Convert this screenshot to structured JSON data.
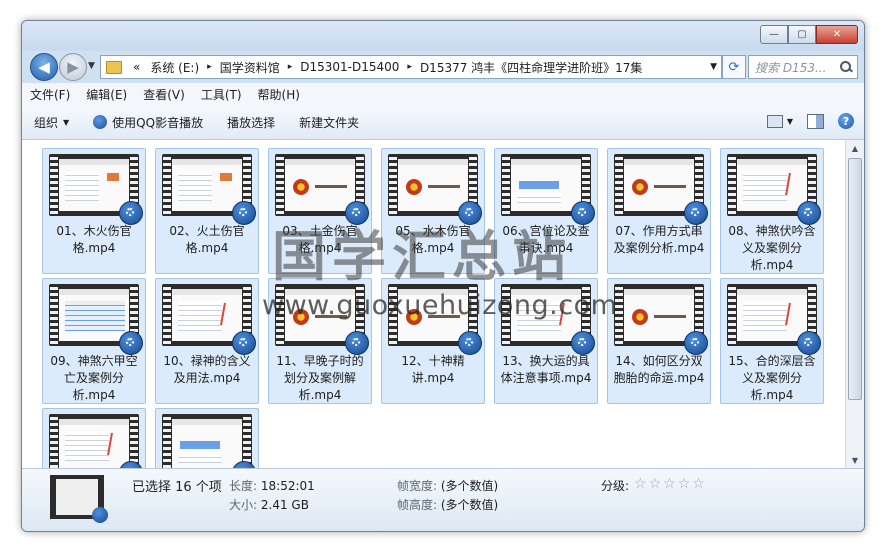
{
  "address": {
    "history_chevron": "«",
    "crumbs": [
      "系统 (E:)",
      "国学资料馆",
      "D15301-D15400",
      "D15377 鸿丰《四柱命理学进阶班》17集"
    ],
    "separator": "▸"
  },
  "search": {
    "placeholder": "搜索 D153..."
  },
  "menu": [
    "文件(F)",
    "编辑(E)",
    "查看(V)",
    "工具(T)",
    "帮助(H)"
  ],
  "toolbar": {
    "organize": "组织",
    "play_qq": "使用QQ影音播放",
    "play_select": "播放选择",
    "new_folder": "新建文件夹"
  },
  "window_buttons": {
    "minimize": "—",
    "maximize": "▢",
    "close": "✕"
  },
  "files": [
    {
      "name": "01、木火伤官格.mp4",
      "thumb": "slides"
    },
    {
      "name": "02、火土伤官格.mp4",
      "thumb": "slides"
    },
    {
      "name": "03、土金伤官格.mp4",
      "thumb": "logo"
    },
    {
      "name": "05、水木伤官格.mp4",
      "thumb": "logo"
    },
    {
      "name": "06、宫位论及查事诀.mp4",
      "thumb": "screen"
    },
    {
      "name": "07、作用方式串及案例分析.mp4",
      "thumb": "logo"
    },
    {
      "name": "08、神煞伏吟含义及案例分析.mp4",
      "thumb": "notes"
    },
    {
      "name": "09、神煞六甲空亡及案例分析.mp4",
      "thumb": "table"
    },
    {
      "name": "10、禄神的含义及用法.mp4",
      "thumb": "notes"
    },
    {
      "name": "11、早晚子时的划分及案例解析.mp4",
      "thumb": "logo"
    },
    {
      "name": "12、十神精讲.mp4",
      "thumb": "logo"
    },
    {
      "name": "13、换大运的具体注意事项.mp4",
      "thumb": "notes"
    },
    {
      "name": "14、如何区分双胞胎的命运.mp4",
      "thumb": "logo"
    },
    {
      "name": "15、合的深层含义及案例分析.mp4",
      "thumb": "notes"
    },
    {
      "name": "",
      "thumb": "notes"
    },
    {
      "name": "",
      "thumb": "screen"
    }
  ],
  "details": {
    "selected": "已选择 16 个项",
    "length_label": "长度:",
    "length_value": "18:52:01",
    "size_label": "大小:",
    "size_value": "2.41 GB",
    "framewidth_label": "帧宽度:",
    "framewidth_value": "(多个数值)",
    "frameheight_label": "帧高度:",
    "frameheight_value": "(多个数值)",
    "rating_label": "分级:",
    "rating_stars": 0,
    "rating_max": 5
  },
  "watermark": {
    "cn": "国学汇总站",
    "url": "www.guoxuehuizong.com"
  },
  "colors": {
    "selection": "#dcebfb",
    "selection_border": "#a5c5e8",
    "accent": "#1f5fae"
  }
}
